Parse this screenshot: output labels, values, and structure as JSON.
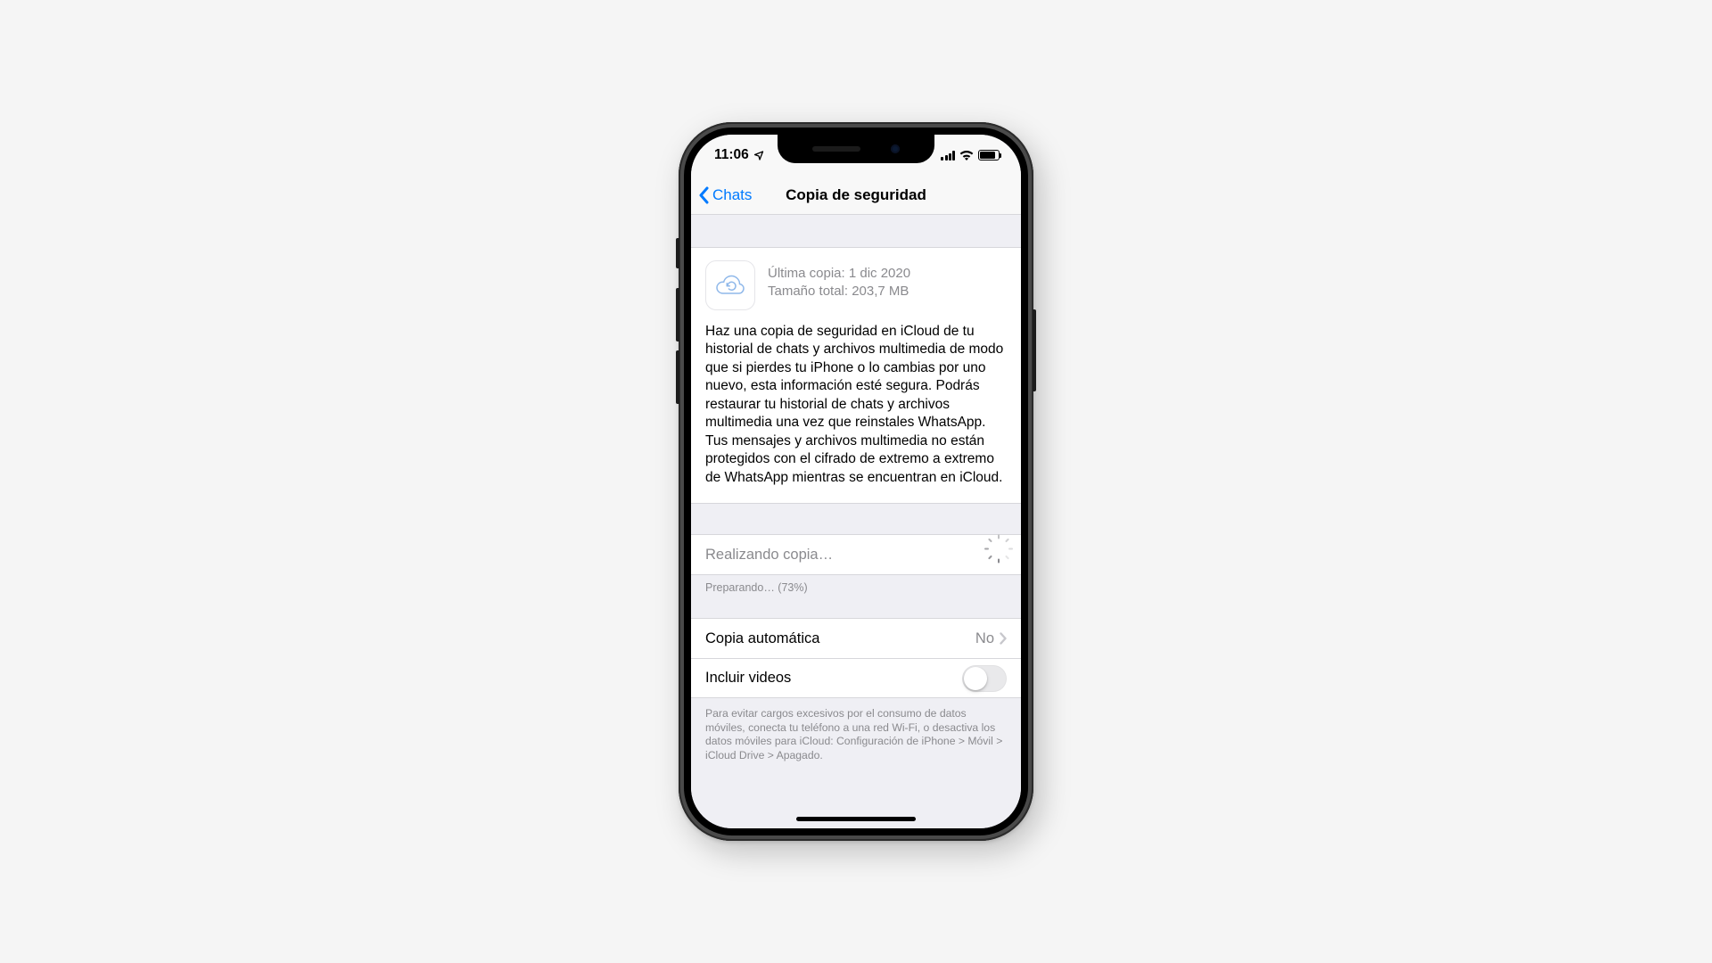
{
  "statusbar": {
    "time": "11:06"
  },
  "navbar": {
    "back_label": "Chats",
    "title": "Copia de seguridad"
  },
  "info": {
    "last_backup": "Última copia: 1 dic 2020",
    "total_size": "Tamaño total: 203,7 MB",
    "description": "Haz una copia de seguridad en iCloud de tu historial de chats y archivos multimedia de modo que si pierdes tu iPhone o lo cambias por uno nuevo, esta información esté segura. Podrás restaurar tu historial de chats y archivos multimedia una vez que reinstales WhatsApp. Tus mensajes y archivos multimedia no están protegidos con el cifrado de extremo a extremo de WhatsApp mientras se encuentran en iCloud."
  },
  "progress": {
    "status_label": "Realizando copia…",
    "stage_label": "Preparando… (73%)"
  },
  "settings": {
    "auto_backup_label": "Copia automática",
    "auto_backup_value": "No",
    "include_videos_label": "Incluir videos",
    "footer": "Para evitar cargos excesivos por el consumo de datos móviles, conecta tu teléfono a una red Wi-Fi, o desactiva los datos móviles para iCloud: Configuración de iPhone > Móvil > iCloud Drive > Apagado."
  }
}
